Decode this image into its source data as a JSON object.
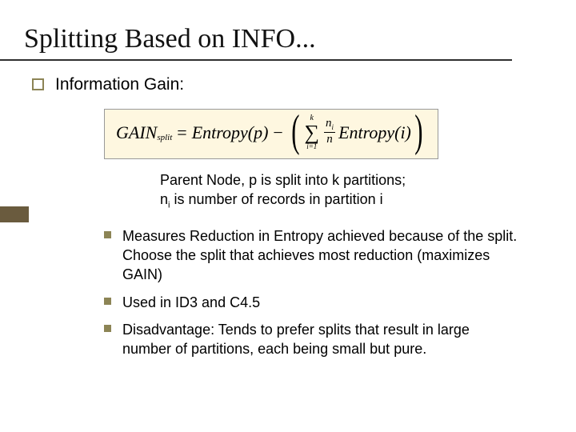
{
  "title": "Splitting Based on INFO...",
  "heading": "Information Gain:",
  "formula": {
    "lhs": "GAIN",
    "lhs_sub": "split",
    "entropy_p": "Entropy(p)",
    "sum_top": "k",
    "sum_bottom": "i=1",
    "frac_num_sym": "n",
    "frac_num_sub": "i",
    "frac_den": "n",
    "entropy_i": "Entropy(i)"
  },
  "caption": {
    "line1": "Parent Node, p is split into k partitions;",
    "line2_pre": "n",
    "line2_sub": "i",
    "line2_post": " is number of records in partition i"
  },
  "points": [
    "Measures Reduction in Entropy achieved because of the split. Choose the split that achieves most reduction (maximizes GAIN)",
    "Used in ID3 and C4.5",
    "Disadvantage: Tends to prefer splits that result in large number of partitions, each being small but pure."
  ]
}
